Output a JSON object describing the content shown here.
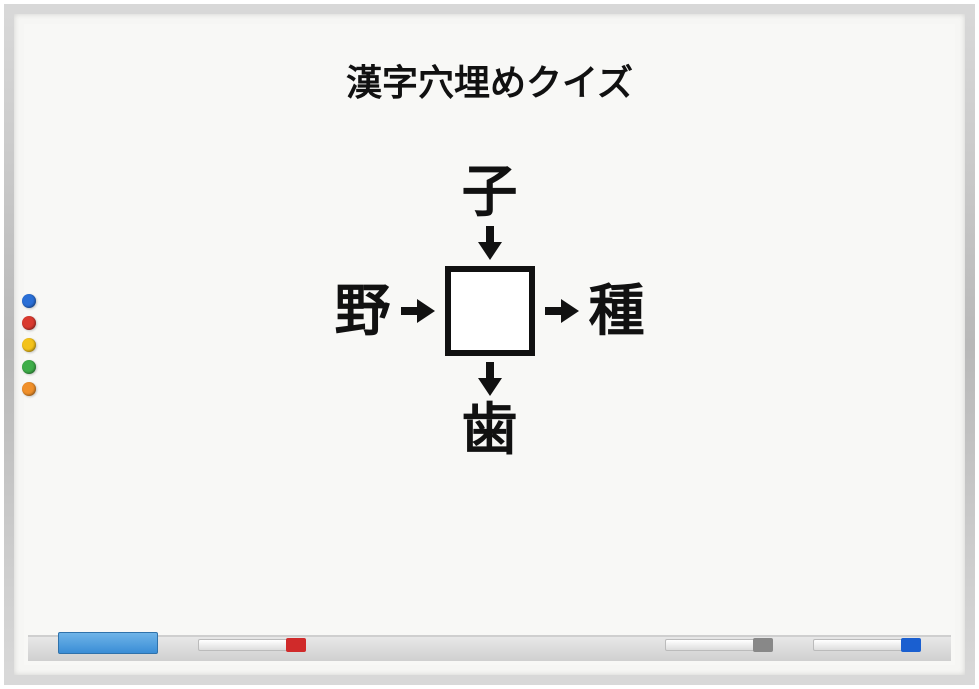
{
  "title": "漢字穴埋めクイズ",
  "puzzle": {
    "top": "子",
    "left": "野",
    "right": "種",
    "bottom": "歯",
    "center": ""
  },
  "magnets": [
    {
      "color": "#2a6fd6"
    },
    {
      "color": "#d93a2f"
    },
    {
      "color": "#f3c21a"
    },
    {
      "color": "#3fae49"
    },
    {
      "color": "#f0902a"
    }
  ],
  "markers": [
    {
      "cap": "#d02a2a"
    },
    {
      "cap": "#888888"
    },
    {
      "cap": "#1a5fd0"
    }
  ]
}
